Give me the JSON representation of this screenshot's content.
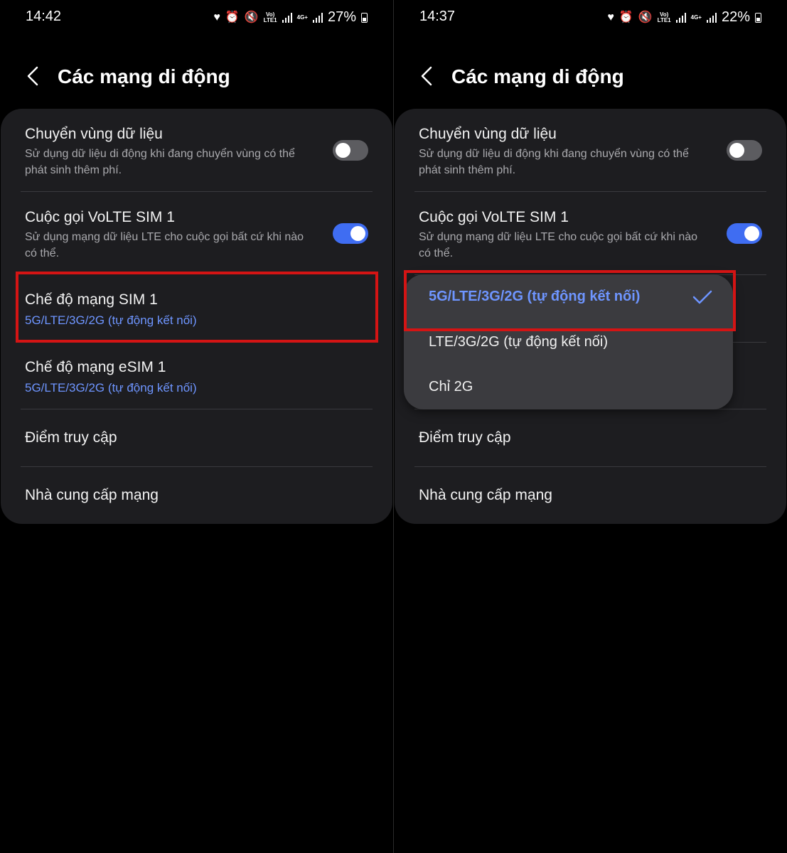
{
  "screens": [
    {
      "status": {
        "time": "14:42",
        "volte": "Vo)",
        "lte1": "LTE1",
        "net": "4G+",
        "battery": "27%"
      },
      "header": {
        "title": "Các mạng di động"
      },
      "settings": {
        "roaming": {
          "title": "Chuyển vùng dữ liệu",
          "sub1": "Sử dụng dữ liệu di động khi đang chuyển vùng có thể",
          "sub2": "phát sinh thêm phí.",
          "enabled": false
        },
        "volte": {
          "title": "Cuộc gọi VoLTE SIM 1",
          "sub1": "Sử dụng mạng dữ liệu LTE cho cuộc gọi bất cứ khi nào",
          "sub2": "có thể.",
          "enabled": true
        },
        "mode_sim1": {
          "title": "Chế độ mạng SIM 1",
          "value": "5G/LTE/3G/2G (tự động kết nối)"
        },
        "mode_esim1": {
          "title": "Chế độ mạng eSIM 1",
          "value": "5G/LTE/3G/2G (tự động kết nối)"
        },
        "apn": {
          "title": "Điểm truy cập"
        },
        "operators": {
          "title": "Nhà cung cấp mạng"
        }
      }
    },
    {
      "status": {
        "time": "14:37",
        "volte": "Vo)",
        "lte1": "LTE1",
        "net": "4G+",
        "battery": "22%"
      },
      "header": {
        "title": "Các mạng di động"
      },
      "settings": {
        "roaming": {
          "title": "Chuyển vùng dữ liệu",
          "sub1": "Sử dụng dữ liệu di động khi đang chuyển vùng có thể",
          "sub2": "phát sinh thêm phí.",
          "enabled": false
        },
        "volte": {
          "title": "Cuộc gọi VoLTE SIM 1",
          "sub1": "Sử dụng mạng dữ liệu LTE cho cuộc gọi bất cứ khi nào",
          "sub2": "có thể.",
          "enabled": true
        },
        "apn": {
          "title": "Điểm truy cập"
        },
        "operators": {
          "title": "Nhà cung cấp mạng"
        }
      },
      "dropdown": {
        "options": [
          "5G/LTE/3G/2G (tự động kết nối)",
          "LTE/3G/2G (tự động kết nối)",
          "Chỉ 2G"
        ],
        "selected_index": 0
      }
    }
  ],
  "colors": {
    "accent": "#6e95ff",
    "toggle_on": "#3f6df2",
    "highlight": "#d41414",
    "card": "#1d1d20",
    "dropdown": "#3b3b3f"
  },
  "icons": [
    "heart-icon",
    "alarm-icon",
    "mute-icon",
    "signal-icon",
    "battery-icon",
    "back-arrow-icon",
    "check-icon"
  ]
}
